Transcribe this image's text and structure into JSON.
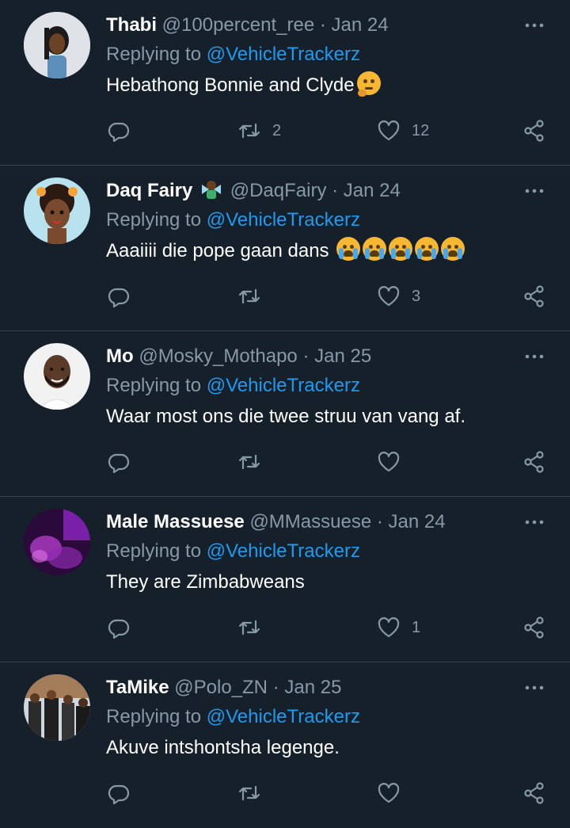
{
  "replying_label": "Replying to",
  "tweets": [
    {
      "name": "Thabi",
      "handle": "@100percent_ree",
      "date": "Jan 24",
      "mention": "@VehicleTrackerz",
      "text": "Hebathong Bonnie and Clyde",
      "retweets": "2",
      "likes": "12",
      "avatar": "woman-profile-photo"
    },
    {
      "name": "Daq Fairy",
      "handle": "@DaqFairy",
      "date": "Jan 24",
      "mention": "@VehicleTrackerz",
      "text": "Aaaiiii die pope gaan dans",
      "retweets": "",
      "likes": "3",
      "avatar": "cartoon-girl-avatar"
    },
    {
      "name": "Mo",
      "handle": "@Mosky_Mothapo",
      "date": "Jan 25",
      "mention": "@VehicleTrackerz",
      "text": "Waar most ons die twee struu van vang af.",
      "retweets": "",
      "likes": "",
      "avatar": "man-profile-photo"
    },
    {
      "name": "Male Massuese",
      "handle": "@MMassuese",
      "date": "Jan 24",
      "mention": "@VehicleTrackerz",
      "text": "They are Zimbabweans",
      "retweets": "",
      "likes": "1",
      "avatar": "purple-photo-avatar"
    },
    {
      "name": "TaMike",
      "handle": "@Polo_ZN",
      "date": "Jan 25",
      "mention": "@VehicleTrackerz",
      "text": "Akuve intshontsha legenge.",
      "retweets": "",
      "likes": "",
      "avatar": "group-photo-avatar"
    }
  ],
  "colors": {
    "background": "#15202b",
    "secondary_text": "#8899a6",
    "mention": "#1d9bf0",
    "divider": "#38444d"
  }
}
